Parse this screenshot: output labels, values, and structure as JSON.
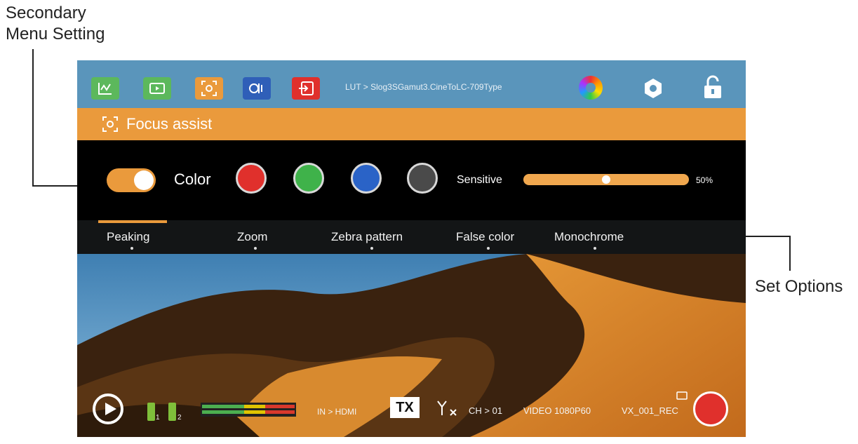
{
  "callouts": {
    "secondary_menu_line1": "Secondary",
    "secondary_menu_line2": "Menu Setting",
    "set_options": "Set Options"
  },
  "topbar": {
    "buttons": [
      {
        "icon": "waveform-icon",
        "color": "#5cb85c"
      },
      {
        "icon": "video-icon",
        "color": "#5cb85c"
      },
      {
        "icon": "focus-icon",
        "color": "#ea9a3c"
      },
      {
        "icon": "audio-icon",
        "color": "#2f5fb8"
      },
      {
        "icon": "input-icon",
        "color": "#e0302c"
      }
    ],
    "lut_text": "LUT > Slog3SGamut3.CineToLC-709Type",
    "color_wheel_icon": "color-wheel-icon",
    "settings_icon": "gear-icon",
    "lock_icon": "lock-icon"
  },
  "submenu": {
    "icon": "focus-icon",
    "title": "Focus assist"
  },
  "panel": {
    "toggle_on": true,
    "color_label": "Color",
    "swatches": [
      "#e0302c",
      "#3fb24a",
      "#2a63c7",
      "#4a4a4a"
    ],
    "sensitive_label": "Sensitive",
    "sensitive_value": "50%",
    "sensitive_fraction": 0.5
  },
  "tabs": [
    "Peaking",
    "Zoom",
    "Zebra pattern",
    "False color",
    "Monochrome"
  ],
  "status": {
    "battery_1": "1",
    "battery_2": "2",
    "input": "IN > HDMI",
    "tx": "TX",
    "channel": "CH > 01",
    "video": "VIDEO 1080P60",
    "file": "VX_001_REC"
  },
  "colors": {
    "topbar": "#5a95bb",
    "accent_orange": "#ea9a3c",
    "record": "#e0302c"
  }
}
